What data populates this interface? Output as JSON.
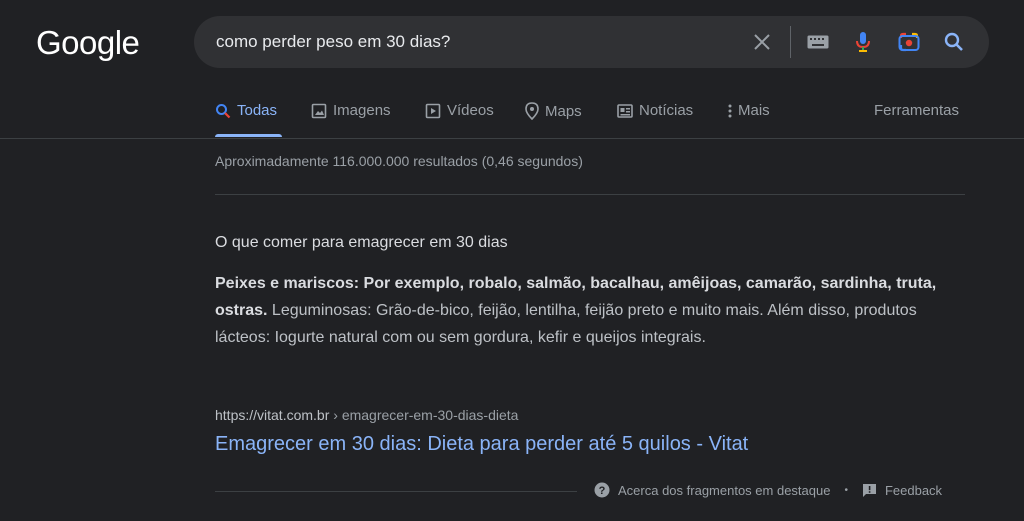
{
  "logo": "Google",
  "search": {
    "query": "como perder peso em 30 dias?"
  },
  "tabs": [
    {
      "label": "Todas",
      "icon": "search-icon",
      "active": true
    },
    {
      "label": "Imagens",
      "icon": "image-icon"
    },
    {
      "label": "Vídeos",
      "icon": "video-icon"
    },
    {
      "label": "Maps",
      "icon": "map-pin-icon"
    },
    {
      "label": "Notícias",
      "icon": "news-icon"
    },
    {
      "label": "Mais",
      "icon": "more-vert-icon"
    }
  ],
  "tools_label": "Ferramentas",
  "stats": "Aproximadamente 116.000.000 resultados (0,46 segundos)",
  "snippet": {
    "heading": "O que comer para emagrecer em 30 dias",
    "bold_text": "Peixes e mariscos: Por exemplo, robalo, salmão, bacalhau, amêijoas, camarão, sardinha, truta, ostras.",
    "rest_text": " Leguminosas: Grão-de-bico, feijão, lentilha, feijão preto e muito mais. Além disso, produtos lácteos: Iogurte natural com ou sem gordura, kefir e queijos integrais."
  },
  "result": {
    "domain": "https://vitat.com.br",
    "breadcrumb": " › emagrecer-em-30-dias-dieta",
    "title": "Emagrecer em 30 dias: Dieta para perder até 5 quilos - Vitat"
  },
  "footer": {
    "about": "Acerca dos fragmentos em destaque",
    "separator": "•",
    "feedback": "Feedback"
  },
  "colors": {
    "background": "#202124",
    "link": "#8ab4f8",
    "search_bar": "#303134"
  }
}
